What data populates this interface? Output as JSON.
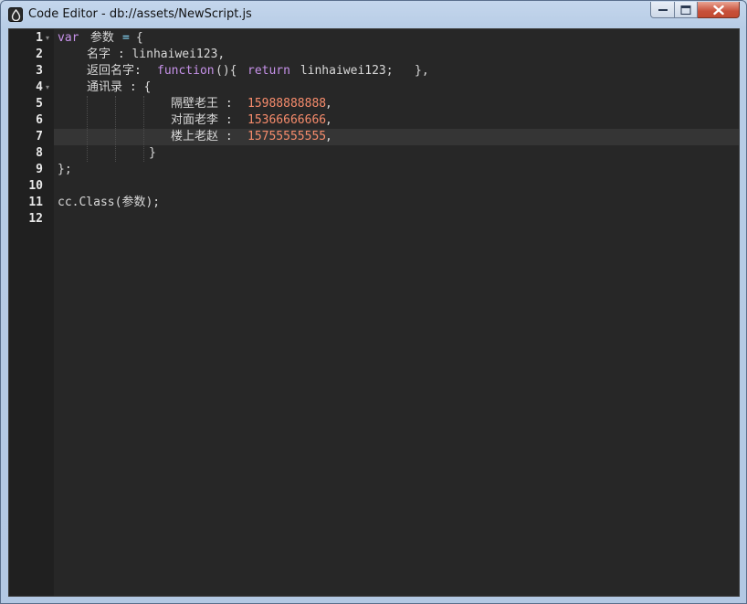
{
  "window": {
    "title": "Code Editor - db://assets/NewScript.js"
  },
  "colors": {
    "keyword": "#c792ea",
    "operator": "#89ddff",
    "number": "#f78c6c",
    "text": "#d8d8d8",
    "editor_bg": "#272727",
    "gutter_bg": "#202020",
    "active_line_bg": "#353535"
  },
  "icons": {
    "app": "cocos-logo-icon",
    "minimize": "minimize-icon",
    "maximize": "restore-icon",
    "close": "close-icon",
    "fold": "fold-arrow-icon"
  },
  "editor": {
    "active_line": 7,
    "line_numbers": [
      "1",
      "2",
      "3",
      "4",
      "5",
      "6",
      "7",
      "8",
      "9",
      "10",
      "11",
      "12"
    ],
    "lines": [
      {
        "number": "1",
        "tokens": [
          "var",
          " 参数 ",
          "=",
          " {"
        ]
      },
      {
        "number": "2",
        "tokens": [
          "名字 : linhaiwei123,"
        ]
      },
      {
        "number": "3",
        "tokens": [
          "返回名字: ",
          "function",
          "(){  ",
          "return",
          " linhaiwei123;   },"
        ]
      },
      {
        "number": "4",
        "tokens": [
          "通讯录 : {"
        ]
      },
      {
        "number": "5",
        "tokens": [
          "隔壁老王 : ",
          "15988888888",
          ","
        ]
      },
      {
        "number": "6",
        "tokens": [
          "对面老李 : ",
          "15366666666",
          ","
        ]
      },
      {
        "number": "7",
        "tokens": [
          "楼上老赵 : ",
          "15755555555",
          ","
        ]
      },
      {
        "number": "8",
        "tokens": [
          "}"
        ]
      },
      {
        "number": "9",
        "tokens": [
          "};"
        ]
      },
      {
        "number": "10",
        "tokens": []
      },
      {
        "number": "11",
        "tokens": [
          "cc.Class(参数);"
        ]
      },
      {
        "number": "12",
        "tokens": []
      }
    ]
  }
}
